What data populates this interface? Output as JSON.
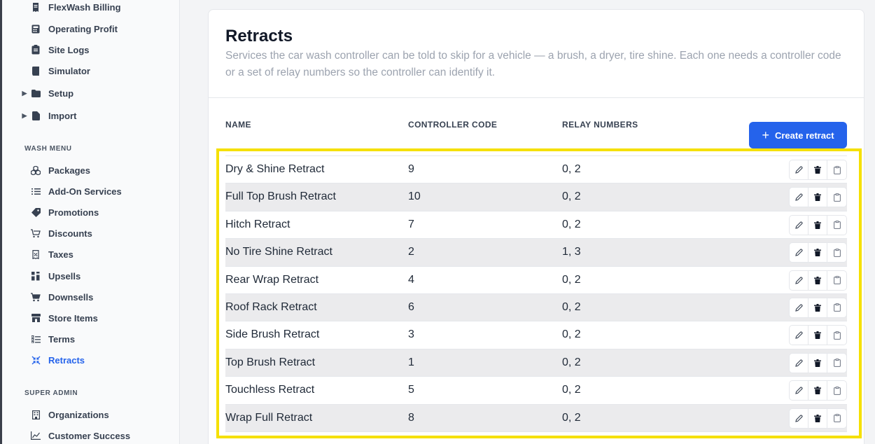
{
  "sidebar": {
    "top_items": [
      {
        "label": "FlexWash Billing",
        "icon": "receipt-icon"
      },
      {
        "label": "Operating Profit",
        "icon": "calculator-icon"
      },
      {
        "label": "Site Logs",
        "icon": "clipboard-icon"
      },
      {
        "label": "Simulator",
        "icon": "book-icon"
      },
      {
        "label": "Setup",
        "icon": "folder-icon",
        "expandable": true
      },
      {
        "label": "Import",
        "icon": "file-icon",
        "expandable": true
      }
    ],
    "wash_menu_label": "WASH MENU",
    "wash_menu_items": [
      {
        "label": "Packages",
        "icon": "packages-icon"
      },
      {
        "label": "Add-On Services",
        "icon": "list-icon"
      },
      {
        "label": "Promotions",
        "icon": "tag-icon"
      },
      {
        "label": "Discounts",
        "icon": "cart-discount-icon"
      },
      {
        "label": "Taxes",
        "icon": "receipt-tax-icon"
      },
      {
        "label": "Upsells",
        "icon": "upsell-icon"
      },
      {
        "label": "Downsells",
        "icon": "cart-icon"
      },
      {
        "label": "Store Items",
        "icon": "store-icon"
      },
      {
        "label": "Terms",
        "icon": "terms-icon"
      },
      {
        "label": "Retracts",
        "icon": "retract-icon",
        "active": true
      }
    ],
    "super_admin_label": "SUPER ADMIN",
    "super_admin_items": [
      {
        "label": "Organizations",
        "icon": "building-icon"
      },
      {
        "label": "Customer Success",
        "icon": "chart-line-icon"
      }
    ]
  },
  "page": {
    "title": "Retracts",
    "description": "Services the car wash controller can be told to skip for a vehicle — a brush, a dryer, tire shine. Each one needs a controller code or a set of relay numbers so the controller can identify it."
  },
  "table": {
    "headers": {
      "name": "NAME",
      "code": "CONTROLLER CODE",
      "relays": "RELAY NUMBERS"
    },
    "create_label": "Create retract",
    "rows": [
      {
        "name": "Dry & Shine Retract",
        "code": "9",
        "relays": "0, 2"
      },
      {
        "name": "Full Top Brush Retract",
        "code": "10",
        "relays": "0, 2"
      },
      {
        "name": "Hitch Retract",
        "code": "7",
        "relays": "0, 2"
      },
      {
        "name": "No Tire Shine Retract",
        "code": "2",
        "relays": "1, 3"
      },
      {
        "name": "Rear Wrap Retract",
        "code": "4",
        "relays": "0, 2"
      },
      {
        "name": "Roof Rack Retract",
        "code": "6",
        "relays": "0, 2"
      },
      {
        "name": "Side Brush Retract",
        "code": "3",
        "relays": "0, 2"
      },
      {
        "name": "Top Brush Retract",
        "code": "1",
        "relays": "0, 2"
      },
      {
        "name": "Touchless Retract",
        "code": "5",
        "relays": "0, 2"
      },
      {
        "name": "Wrap Full Retract",
        "code": "8",
        "relays": "0, 2"
      }
    ],
    "row_actions": [
      "pencil-icon",
      "trash-icon",
      "clipboard-copy-icon"
    ]
  },
  "colors": {
    "accent": "#2563eb",
    "highlight": "#f5e000"
  }
}
